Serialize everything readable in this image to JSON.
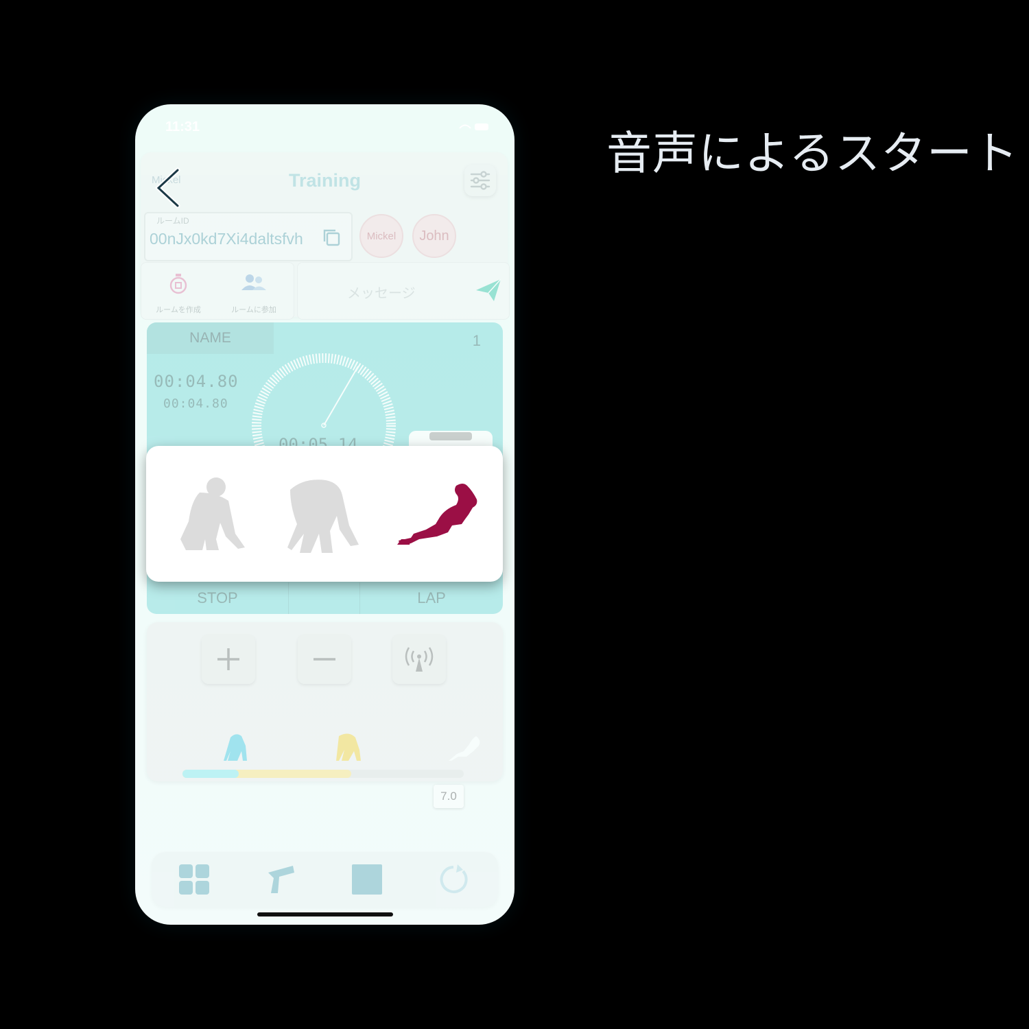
{
  "caption": "音声によるスタート",
  "status": {
    "time": "11:31"
  },
  "header": {
    "user_name": "Mickel",
    "title": "Training"
  },
  "room": {
    "label": "ルームID",
    "id_value": "00nJx0kd7Xi4daltsfvh",
    "members": [
      "Mickel",
      "John"
    ]
  },
  "actions": {
    "create_room": "ルームを作成",
    "join_room": "ルームに参加"
  },
  "message": {
    "placeholder": "メッセージ"
  },
  "timer": {
    "name_label": "NAME",
    "lane_number": "1",
    "main_time": "00:04.80",
    "sub_time": "00:04.80",
    "dial_time": "00:05.14",
    "stop_label": "STOP",
    "lap_label": "LAP"
  },
  "controls": {
    "threshold_value": "7.0",
    "bar": {
      "stage1_fraction": 0.2,
      "stage2_fraction": 0.6
    },
    "colors": {
      "stage1": "#7fe6ee",
      "stage2": "#fbe07a",
      "track": "#dedede"
    }
  },
  "start_sequence": {
    "icons": [
      "on-your-marks-icon",
      "set-icon",
      "go-icon"
    ],
    "active_color": "#9b0f45",
    "inactive_color": "#dcdcdc"
  },
  "bottom_nav": {
    "icons": [
      "grid-icon",
      "start-gun-icon",
      "stop-square-icon",
      "reset-icon"
    ],
    "color": "#8ec7d2"
  }
}
